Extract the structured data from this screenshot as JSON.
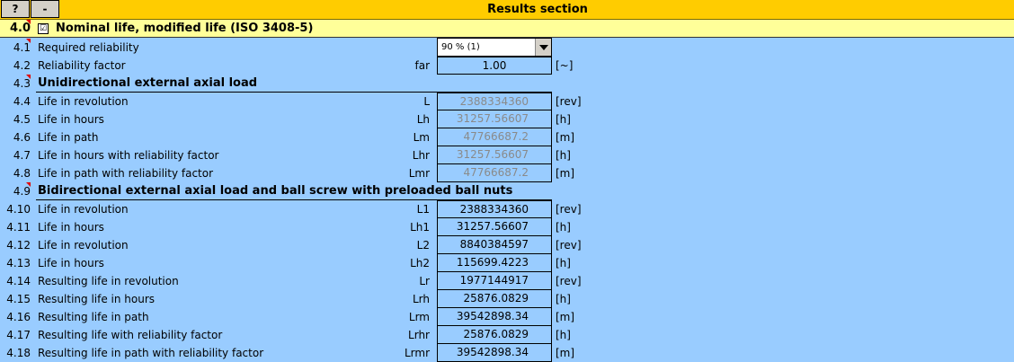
{
  "header": {
    "help_button": "?",
    "collapse_button": "-",
    "title": "Results section"
  },
  "section": {
    "number": "4.0",
    "checkbox_mark": "☑",
    "title": "Nominal life, modified life (ISO 3408-5)"
  },
  "reliability": {
    "number": "4.1",
    "label": "Required reliability",
    "selected": "90 % (1)"
  },
  "rows": [
    {
      "num": "4.2",
      "label": "Reliability factor",
      "symbol": "far",
      "value": "1.00",
      "unit": "[~]"
    },
    {
      "num": "4.3",
      "label": "Unidirectional external axial load",
      "symbol": "",
      "value": "",
      "unit": ""
    },
    {
      "num": "4.4",
      "label": "Life in revolution",
      "symbol": "L",
      "value": "2388334360",
      "unit": "[rev]"
    },
    {
      "num": "4.5",
      "label": "Life in hours",
      "symbol": "Lh",
      "value": "31257.56607",
      "unit": "[h]"
    },
    {
      "num": "4.6",
      "label": "Life in path",
      "symbol": "Lm",
      "value": "47766687.2",
      "unit": "[m]"
    },
    {
      "num": "4.7",
      "label": "Life in hours with reliability factor",
      "symbol": "Lhr",
      "value": "31257.56607",
      "unit": "[h]"
    },
    {
      "num": "4.8",
      "label": "Life in path with reliability factor",
      "symbol": "Lmr",
      "value": "47766687.2",
      "unit": "[m]"
    },
    {
      "num": "4.9",
      "label": "Bidirectional external axial load and ball screw with preloaded ball nuts",
      "symbol": "",
      "value": "",
      "unit": ""
    },
    {
      "num": "4.10",
      "label": "Life in revolution",
      "symbol": "L1",
      "value": "2388334360",
      "unit": "[rev]"
    },
    {
      "num": "4.11",
      "label": "Life in hours",
      "symbol": "Lh1",
      "value": "31257.56607",
      "unit": "[h]"
    },
    {
      "num": "4.12",
      "label": "Life in revolution",
      "symbol": "L2",
      "value": "8840384597",
      "unit": "[rev]"
    },
    {
      "num": "4.13",
      "label": "Life in hours",
      "symbol": "Lh2",
      "value": "115699.4223",
      "unit": "[h]"
    },
    {
      "num": "4.14",
      "label": "Resulting life in revolution",
      "symbol": "Lr",
      "value": "1977144917",
      "unit": "[rev]"
    },
    {
      "num": "4.15",
      "label": "Resulting life in hours",
      "symbol": "Lrh",
      "value": "25876.0829",
      "unit": "[h]"
    },
    {
      "num": "4.16",
      "label": "Resulting life in path",
      "symbol": "Lrm",
      "value": "39542898.34",
      "unit": "[m]"
    },
    {
      "num": "4.17",
      "label": "Resulting life with reliability factor",
      "symbol": "Lrhr",
      "value": "25876.0829",
      "unit": "[h]"
    },
    {
      "num": "4.18",
      "label": "Resulting life in path with reliability factor",
      "symbol": "Lrmr",
      "value": "39542898.34",
      "unit": "[m]"
    }
  ],
  "colors": {
    "background": "#99ccff",
    "header": "#ffcc00",
    "section": "#ffff99",
    "note_marker": "#e00000",
    "disabled_text": "#8a8a8a"
  }
}
